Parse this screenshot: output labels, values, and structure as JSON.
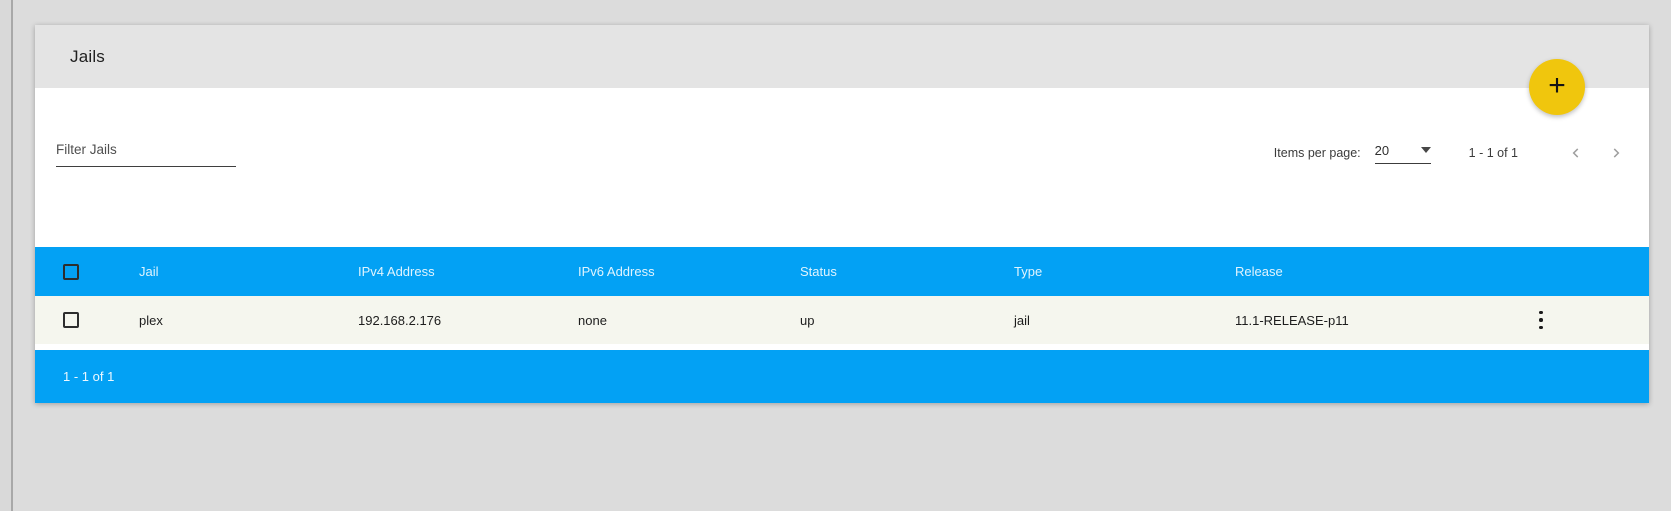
{
  "card": {
    "title": "Jails"
  },
  "icons": {
    "add": "+",
    "dropdown_arrow": "triangle-down",
    "chevron_left": "angle-left",
    "chevron_right": "angle-right",
    "row_menu": "vertical-dots"
  },
  "filter": {
    "placeholder": "Filter Jails",
    "value": ""
  },
  "paginator": {
    "items_per_page_label": "Items per page:",
    "page_size": "20",
    "range": "1 - 1 of 1"
  },
  "table": {
    "header": {
      "columns": [
        "Jail",
        "IPv4 Address",
        "IPv6 Address",
        "Status",
        "Type",
        "Release"
      ]
    },
    "rows": [
      {
        "jail": "plex",
        "ipv4_address": "192.168.2.176",
        "ipv6_address": "none",
        "status": "up",
        "type": "jail",
        "release": "11.1-RELEASE-p11"
      }
    ],
    "footer": {
      "range": "1 - 1 of 1"
    }
  },
  "colors": {
    "accent_blue": "#03a1f4",
    "fab_yellow": "#f0c60d",
    "row_bg": "#f5f6ee",
    "card_header_bg": "#e4e4e4",
    "page_bg": "#dcdcdc"
  }
}
